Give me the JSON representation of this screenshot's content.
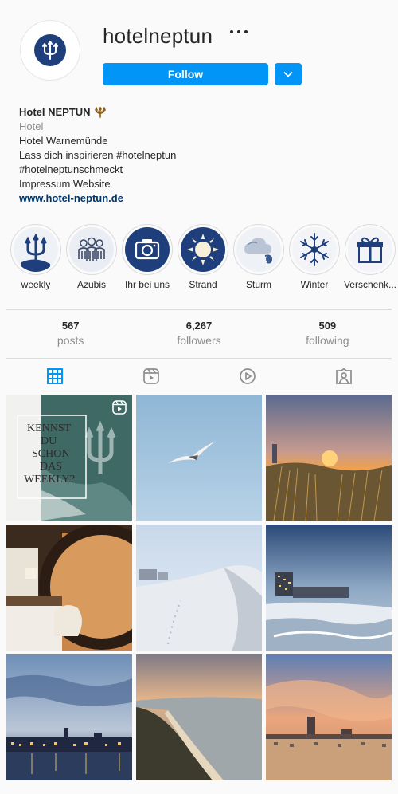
{
  "profile": {
    "username": "hotelneptun",
    "follow_label": "Follow",
    "name": "Hotel NEPTUN",
    "category": "Hotel",
    "bio_lines": [
      "Hotel Warnemünde",
      "Lass dich inspirieren #hotelneptun",
      "#hotelneptunschmeckt",
      "Impressum Website"
    ],
    "website": "www.hotel-neptun.de"
  },
  "highlights": [
    {
      "label": "weekly",
      "icon": "trident-icon"
    },
    {
      "label": "Azubis",
      "icon": "group-icon"
    },
    {
      "label": "Ihr bei uns",
      "icon": "camera-icon"
    },
    {
      "label": "Strand",
      "icon": "sun-icon"
    },
    {
      "label": "Sturm",
      "icon": "wind-cloud-icon"
    },
    {
      "label": "Winter",
      "icon": "snowflake-icon"
    },
    {
      "label": "Verschenk...",
      "icon": "gift-icon"
    }
  ],
  "stats": {
    "posts_count": "567",
    "posts_label": "posts",
    "followers_count": "6,267",
    "followers_label": "followers",
    "following_count": "509",
    "following_label": "following"
  },
  "tabs": [
    "grid-icon",
    "reels-icon",
    "igtv-icon",
    "tagged-icon"
  ],
  "posts": {
    "first_post_text": [
      "KENNST",
      "DU",
      "SCHON",
      "DAS",
      "WEEKLY?"
    ]
  },
  "colors": {
    "accent": "#0095f6",
    "brand_navy": "#1f3f7c",
    "text": "#262626",
    "muted": "#8e8e8e",
    "link": "#00376b"
  }
}
